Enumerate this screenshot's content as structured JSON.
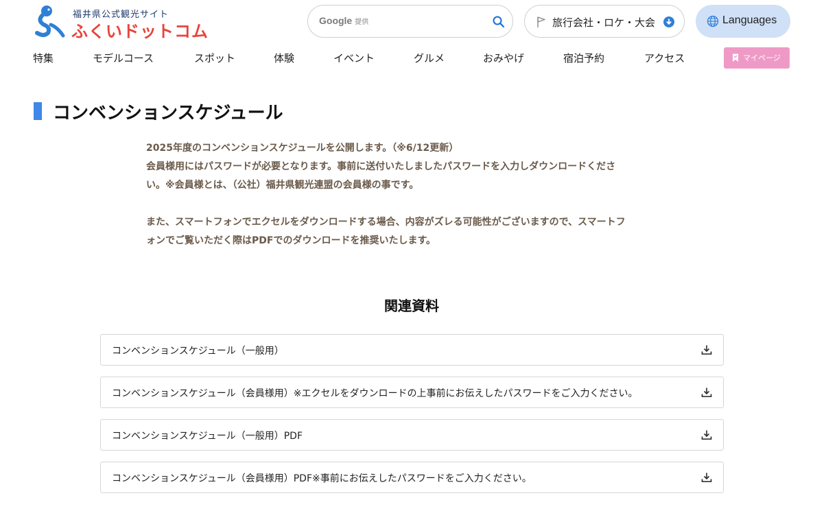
{
  "header": {
    "logo_sub": "福井県公式観光サイト",
    "logo_main": "ふくいドットコム",
    "search": {
      "brand_google": "Google",
      "brand_provided": "提供",
      "value": "",
      "placeholder": "",
      "icon": "search-icon"
    },
    "travel_button": {
      "label": "旅行会社・ロケ・大会",
      "icon": "flag-icon",
      "badge_icon": "download-circle-icon"
    },
    "language_button": {
      "label": "Languages",
      "icon": "globe-icon"
    }
  },
  "nav": {
    "items": [
      "特集",
      "モデルコース",
      "スポット",
      "体験",
      "イベント",
      "グルメ",
      "おみやげ",
      "宿泊予約",
      "アクセス"
    ],
    "mypage": {
      "label": "マイページ",
      "icon": "bookmark-icon"
    }
  },
  "main": {
    "title": "コンベンションスケジュール",
    "intro_lines": [
      "2025年度のコンベンションスケジュールを公開します。（※6/12更新）",
      "会員様用にはパスワードが必要となります。事前に送付いたしましたパスワードを入力しダウンロードくださ",
      "い。※会員様とは、（公社）福井県観光連盟の会員様の事です。",
      "また、スマートフォンでエクセルをダウンロードする場合、内容がズレる可能性がございますので、スマートフ",
      "ォンでご覧いただく際はPDFでのダウンロードを推奨いたします。"
    ],
    "related_title": "関連資料",
    "documents": [
      {
        "label": "コンベンションスケジュール（一般用）",
        "icon": "download-icon"
      },
      {
        "label": "コンベンションスケジュール（会員様用）※エクセルをダウンロードの上事前にお伝えしたパスワードをご入力ください。",
        "icon": "download-icon"
      },
      {
        "label": "コンベンションスケジュール（一般用）PDF",
        "icon": "download-icon"
      },
      {
        "label": "コンベンションスケジュール（会員様用）PDF※事前にお伝えしたパスワードをご入力ください。",
        "icon": "download-icon"
      }
    ]
  },
  "colors": {
    "logo_red": "#e8443b",
    "logo_blue": "#2f7fd6",
    "title_accent": "#3f87e8",
    "language_bg": "#cfe0f7",
    "mypage_bg": "#ef9ac6",
    "intro_text": "#6a5a4a"
  }
}
